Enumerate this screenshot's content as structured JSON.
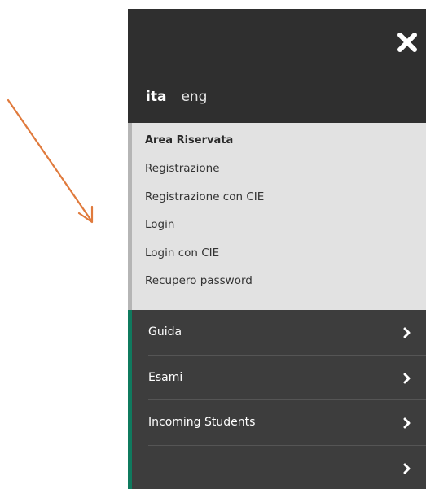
{
  "colors": {
    "header_bg": "#2f2f2f",
    "reserved_bg": "#e2e2e2",
    "nav_bg": "#3d3d3d",
    "nav_accent": "#0f7a5e",
    "arrow": "#e07a3c"
  },
  "header": {
    "close_icon": "close-icon",
    "languages": [
      {
        "label": "ita",
        "active": true
      },
      {
        "label": "eng",
        "active": false
      }
    ]
  },
  "reserved_area": {
    "title": "Area Riservata",
    "links": [
      {
        "label": "Registrazione"
      },
      {
        "label": "Registrazione con CIE"
      },
      {
        "label": "Login"
      },
      {
        "label": "Login con CIE"
      },
      {
        "label": "Recupero password"
      }
    ]
  },
  "nav": {
    "items": [
      {
        "label": "Guida",
        "icon": "chevron-right-icon"
      },
      {
        "label": "Esami",
        "icon": "chevron-right-icon"
      },
      {
        "label": "Incoming Students",
        "icon": "chevron-right-icon"
      },
      {
        "label": "",
        "icon": "chevron-right-icon"
      }
    ]
  }
}
